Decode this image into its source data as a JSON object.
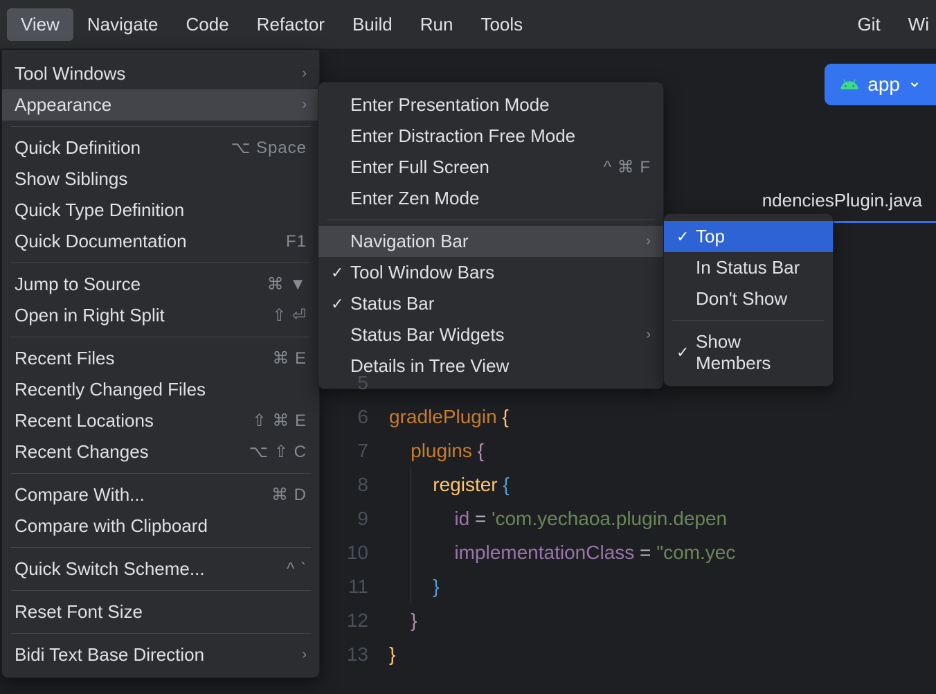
{
  "menubar": {
    "view": "View",
    "navigate": "Navigate",
    "code": "Code",
    "refactor": "Refactor",
    "build": "Build",
    "run": "Run",
    "tools": "Tools",
    "git": "Git",
    "win": "Wi"
  },
  "runconfig": {
    "label": "app"
  },
  "tab": {
    "filename": "ndenciesPlugin.java"
  },
  "viewMenu": {
    "toolWindows": "Tool Windows",
    "appearance": "Appearance",
    "quickDefinition": "Quick Definition",
    "quickDefinitionKey": "⌥ Space",
    "showSiblings": "Show Siblings",
    "quickTypeDef": "Quick Type Definition",
    "quickDoc": "Quick Documentation",
    "quickDocKey": "F1",
    "jumpToSource": "Jump to Source",
    "jumpToSourceKey": "⌘ ▼",
    "openRightSplit": "Open in Right Split",
    "openRightSplitKey": "⇧ ⏎",
    "recentFiles": "Recent Files",
    "recentFilesKey": "⌘ E",
    "recentlyChanged": "Recently Changed Files",
    "recentLocations": "Recent Locations",
    "recentLocationsKey": "⇧ ⌘ E",
    "recentChanges": "Recent Changes",
    "recentChangesKey": "⌥ ⇧ C",
    "compareWith": "Compare With...",
    "compareWithKey": "⌘ D",
    "compareClipboard": "Compare with Clipboard",
    "quickSwitch": "Quick Switch Scheme...",
    "quickSwitchKey": "^ `",
    "resetFont": "Reset Font Size",
    "bidi": "Bidi Text Base Direction"
  },
  "appearanceMenu": {
    "presentation": "Enter Presentation Mode",
    "distractionFree": "Enter Distraction Free Mode",
    "fullScreen": "Enter Full Screen",
    "fullScreenKey": "^ ⌘ F",
    "zenMode": "Enter Zen Mode",
    "navBar": "Navigation Bar",
    "toolWindowBars": "Tool Window Bars",
    "statusBar": "Status Bar",
    "statusBarWidgets": "Status Bar Widgets",
    "detailsTree": "Details in Tree View"
  },
  "navBarMenu": {
    "top": "Top",
    "inStatusBar": "In Status Bar",
    "dontShow": "Don't Show",
    "showMembers": "Show Members"
  },
  "editor": {
    "lines": [
      {
        "n": "5",
        "t": ""
      },
      {
        "n": "6",
        "t": "gradlePlugin {"
      },
      {
        "n": "7",
        "t": "    plugins {"
      },
      {
        "n": "8",
        "t": "        register {"
      },
      {
        "n": "9",
        "t": "            id = 'com.yechaoa.plugin.depen"
      },
      {
        "n": "10",
        "t": "            implementationClass = \"com.yec"
      },
      {
        "n": "11",
        "t": "        }"
      },
      {
        "n": "12",
        "t": "    }"
      },
      {
        "n": "13",
        "t": "}"
      }
    ]
  }
}
